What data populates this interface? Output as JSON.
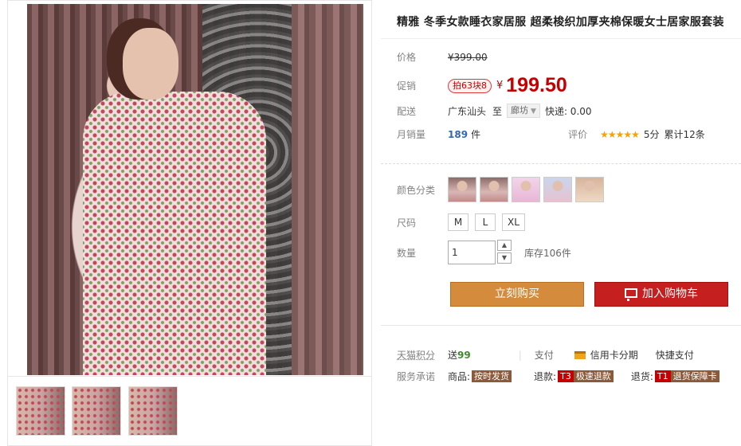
{
  "product": {
    "title": "精雅 冬季女款睡衣家居服 超柔梭织加厚夹棉保暖女士居家服套装"
  },
  "price": {
    "label": "价格",
    "original": "¥399.00"
  },
  "promo": {
    "label": "促销",
    "badge": "拍63块8",
    "currency": "¥",
    "price": "199.50"
  },
  "shipping": {
    "label": "配送",
    "from": "广东汕头",
    "to_label": "至",
    "destination": "廊坊",
    "express": "快递: 0.00"
  },
  "sales": {
    "label": "月销量",
    "count": "189",
    "unit": "件",
    "rating_label": "评价",
    "stars": "★★★★★",
    "score": "5分",
    "reviews": "累计12条"
  },
  "color": {
    "label": "颜色分类",
    "swatches": [
      "swatch-1",
      "swatch-2",
      "swatch-3",
      "swatch-4",
      "swatch-5"
    ]
  },
  "size": {
    "label": "尺码",
    "options": [
      "M",
      "L",
      "XL"
    ]
  },
  "quantity": {
    "label": "数量",
    "value": "1",
    "stock": "库存106件"
  },
  "actions": {
    "buy_now": "立刻购买",
    "add_to_cart": "加入购物车"
  },
  "points": {
    "label": "天猫积分",
    "value_prefix": "送",
    "value": "99",
    "pay_label": "支付",
    "installment": "信用卡分期",
    "quick_pay": "快捷支付"
  },
  "service": {
    "label": "服务承诺",
    "goods_label": "商品:",
    "goods_tag": "按时发货",
    "refund_label": "退款:",
    "refund_code": "T3",
    "refund_tag": "极速退款",
    "return_label": "退货:",
    "return_code": "T1",
    "return_tag": "退货保障卡"
  },
  "colors": {
    "accent_red": "#c40000",
    "buy_orange": "#d48b3b",
    "cart_red": "#c5201f"
  }
}
